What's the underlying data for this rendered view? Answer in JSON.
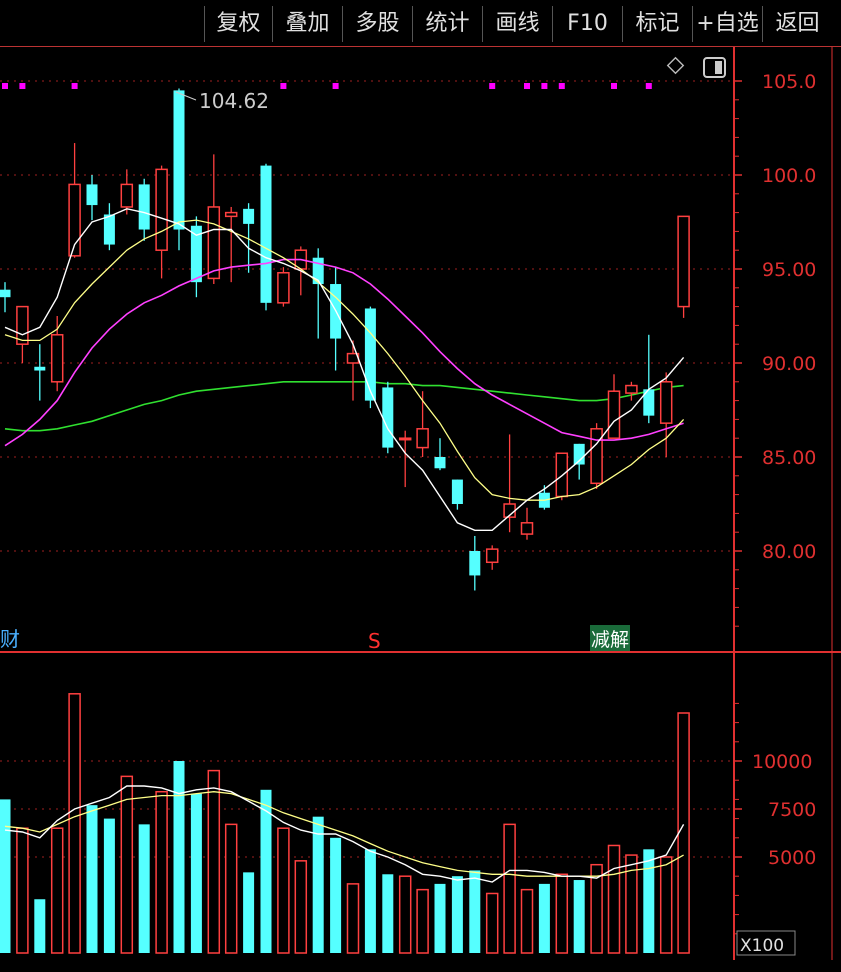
{
  "toolbar": {
    "buttons": [
      "复权",
      "叠加",
      "多股",
      "统计",
      "画线",
      "F10",
      "标记",
      "+自选",
      "返回"
    ]
  },
  "markers": {
    "left_tag": "财",
    "s_tag": "S",
    "jie_tag": "减解"
  },
  "colors": {
    "up": "#ff4040",
    "down": "#55ffff",
    "ma5": "#ffffff",
    "ma10": "#ffff88",
    "ma20": "#ff40ff",
    "ma60": "#30e030",
    "grid": "#a02020",
    "axis": "#e03030",
    "dot": "#ff00ff"
  },
  "chart_data": [
    {
      "type": "candlestick",
      "high_label": "104.62",
      "ylim": [
        75.7,
        106.0
      ],
      "y_ticks": [
        "105.0",
        "100.0",
        "95.00",
        "90.00",
        "85.00",
        "80.00"
      ],
      "y_tick_values": [
        105,
        100,
        95,
        90,
        85,
        80
      ],
      "candles": [
        {
          "o": 93.9,
          "h": 94.3,
          "l": 92.7,
          "c": 93.5
        },
        {
          "o": 91.0,
          "h": 93.0,
          "l": 90.0,
          "c": 93.0
        },
        {
          "o": 89.8,
          "h": 91.0,
          "l": 88.0,
          "c": 89.6
        },
        {
          "o": 89.0,
          "h": 92.5,
          "l": 88.5,
          "c": 91.5
        },
        {
          "o": 95.7,
          "h": 101.7,
          "l": 95.6,
          "c": 99.5
        },
        {
          "o": 99.5,
          "h": 100.0,
          "l": 97.6,
          "c": 98.4
        },
        {
          "o": 97.9,
          "h": 98.5,
          "l": 96.0,
          "c": 96.3
        },
        {
          "o": 98.3,
          "h": 100.3,
          "l": 97.9,
          "c": 99.5
        },
        {
          "o": 99.5,
          "h": 99.8,
          "l": 96.5,
          "c": 97.1
        },
        {
          "o": 96.0,
          "h": 100.5,
          "l": 94.5,
          "c": 100.3
        },
        {
          "o": 104.5,
          "h": 104.6,
          "l": 96.0,
          "c": 97.1
        },
        {
          "o": 97.3,
          "h": 97.8,
          "l": 93.5,
          "c": 94.3
        },
        {
          "o": 94.5,
          "h": 101.1,
          "l": 94.2,
          "c": 98.3
        },
        {
          "o": 97.8,
          "h": 98.3,
          "l": 94.3,
          "c": 98.0
        },
        {
          "o": 98.2,
          "h": 98.5,
          "l": 94.8,
          "c": 97.4
        },
        {
          "o": 100.5,
          "h": 100.6,
          "l": 92.8,
          "c": 93.2
        },
        {
          "o": 93.2,
          "h": 95.1,
          "l": 93.0,
          "c": 94.8
        },
        {
          "o": 95.0,
          "h": 96.2,
          "l": 93.6,
          "c": 96.0
        },
        {
          "o": 95.6,
          "h": 96.1,
          "l": 91.3,
          "c": 94.2
        },
        {
          "o": 94.2,
          "h": 95.1,
          "l": 89.6,
          "c": 91.3
        },
        {
          "o": 90.0,
          "h": 91.2,
          "l": 88.0,
          "c": 90.5
        },
        {
          "o": 92.9,
          "h": 93.0,
          "l": 87.6,
          "c": 88.0
        },
        {
          "o": 88.7,
          "h": 89.0,
          "l": 85.2,
          "c": 85.5
        },
        {
          "o": 86.0,
          "h": 86.4,
          "l": 83.4,
          "c": 86.0
        },
        {
          "o": 85.5,
          "h": 88.5,
          "l": 85.0,
          "c": 86.5
        },
        {
          "o": 85.0,
          "h": 86.0,
          "l": 84.3,
          "c": 84.4
        },
        {
          "o": 83.8,
          "h": 83.8,
          "l": 82.2,
          "c": 82.5
        },
        {
          "o": 80.0,
          "h": 80.8,
          "l": 77.9,
          "c": 78.7
        },
        {
          "o": 79.4,
          "h": 80.3,
          "l": 79.0,
          "c": 80.1
        },
        {
          "o": 81.8,
          "h": 86.2,
          "l": 81.0,
          "c": 82.5
        },
        {
          "o": 80.9,
          "h": 82.3,
          "l": 80.6,
          "c": 81.5
        },
        {
          "o": 83.1,
          "h": 83.5,
          "l": 82.2,
          "c": 82.3
        },
        {
          "o": 82.9,
          "h": 85.2,
          "l": 82.7,
          "c": 85.2
        },
        {
          "o": 85.7,
          "h": 85.7,
          "l": 83.8,
          "c": 84.6
        },
        {
          "o": 83.6,
          "h": 86.8,
          "l": 83.3,
          "c": 86.5
        },
        {
          "o": 86.0,
          "h": 89.4,
          "l": 86.0,
          "c": 88.5
        },
        {
          "o": 88.4,
          "h": 89.0,
          "l": 88.0,
          "c": 88.8
        },
        {
          "o": 88.6,
          "h": 91.5,
          "l": 86.8,
          "c": 87.2
        },
        {
          "o": 86.8,
          "h": 89.5,
          "l": 85.0,
          "c": 89.0
        },
        {
          "o": 93.0,
          "h": 97.8,
          "l": 92.4,
          "c": 97.8
        }
      ],
      "ma5": [
        91.9,
        91.5,
        91.9,
        93.5,
        96.3,
        97.5,
        97.8,
        98.2,
        98.0,
        97.7,
        97.4,
        96.8,
        97.1,
        97.1,
        96.1,
        95.6,
        95.3,
        94.9,
        94.4,
        92.8,
        91.0,
        88.5,
        86.5,
        85.2,
        84.3,
        82.9,
        81.5,
        81.1,
        81.1,
        81.9,
        82.7,
        83.3,
        84.0,
        84.8,
        85.7,
        86.9,
        87.5,
        88.6,
        89.2,
        90.3
      ],
      "ma10": [
        91.5,
        91.2,
        91.2,
        91.8,
        93.2,
        94.2,
        95.1,
        96.0,
        96.6,
        97.0,
        97.5,
        97.6,
        97.4,
        97.0,
        96.6,
        96.1,
        95.6,
        95.0,
        94.3,
        93.5,
        92.6,
        91.6,
        90.5,
        89.3,
        88.0,
        86.8,
        85.3,
        83.9,
        83.0,
        82.8,
        82.7,
        82.7,
        82.9,
        83.0,
        83.4,
        84.0,
        84.6,
        85.4,
        86.0,
        87.0
      ],
      "ma20": [
        85.6,
        86.2,
        87.0,
        88.0,
        89.5,
        90.8,
        91.8,
        92.6,
        93.2,
        93.6,
        94.1,
        94.5,
        94.9,
        95.1,
        95.2,
        95.3,
        95.5,
        95.5,
        95.3,
        95.1,
        94.8,
        94.2,
        93.4,
        92.5,
        91.6,
        90.6,
        89.7,
        88.9,
        88.3,
        87.8,
        87.3,
        86.8,
        86.3,
        86.1,
        85.9,
        85.9,
        86.0,
        86.2,
        86.5,
        86.8
      ],
      "ma60": [
        86.5,
        86.4,
        86.4,
        86.5,
        86.7,
        86.9,
        87.2,
        87.5,
        87.8,
        88.0,
        88.3,
        88.5,
        88.6,
        88.7,
        88.8,
        88.9,
        89.0,
        89.0,
        89.0,
        89.0,
        89.0,
        89.0,
        88.9,
        88.9,
        88.8,
        88.8,
        88.7,
        88.6,
        88.5,
        88.4,
        88.3,
        88.2,
        88.1,
        88.0,
        88.0,
        88.1,
        88.3,
        88.5,
        88.7,
        88.8
      ],
      "dots": [
        true,
        true,
        false,
        false,
        true,
        false,
        false,
        false,
        false,
        false,
        false,
        false,
        false,
        false,
        false,
        false,
        true,
        false,
        false,
        true,
        false,
        false,
        false,
        false,
        false,
        false,
        false,
        false,
        true,
        false,
        true,
        true,
        true,
        false,
        false,
        true,
        false,
        true,
        false,
        false
      ]
    },
    {
      "type": "volume",
      "ylim": [
        0,
        13800
      ],
      "y_ticks": [
        "10000",
        "7500",
        "5000"
      ],
      "y_tick_values": [
        10000,
        7500,
        5000
      ],
      "unit_label": "X100",
      "values": [
        8000,
        6500,
        2800,
        6500,
        13500,
        7700,
        7000,
        9200,
        6700,
        8400,
        10000,
        8300,
        9500,
        6700,
        4200,
        8500,
        6500,
        4800,
        7100,
        6000,
        3600,
        5400,
        4100,
        4000,
        3300,
        3600,
        4000,
        4300,
        3100,
        6700,
        3300,
        3600,
        4100,
        3800,
        4600,
        5600,
        5100,
        5400,
        5000,
        12500
      ],
      "ma5": [
        6400,
        6300,
        6000,
        6900,
        7500,
        7800,
        8100,
        8700,
        8700,
        8600,
        8300,
        8500,
        8600,
        8400,
        7900,
        7400,
        6800,
        6400,
        6200,
        6200,
        5800,
        5300,
        5000,
        4600,
        4100,
        4000,
        3800,
        3900,
        3700,
        4300,
        4300,
        4200,
        4000,
        4000,
        3900,
        4400,
        4600,
        4800,
        5100,
        6700
      ],
      "ma10": [
        6600,
        6500,
        6300,
        6700,
        7100,
        7400,
        7700,
        8000,
        8100,
        8200,
        8200,
        8300,
        8400,
        8300,
        8000,
        7700,
        7300,
        7000,
        6700,
        6400,
        6100,
        5700,
        5300,
        5000,
        4700,
        4500,
        4300,
        4200,
        4100,
        4100,
        4000,
        4000,
        4000,
        4000,
        4000,
        4100,
        4300,
        4400,
        4600,
        5100
      ]
    }
  ]
}
